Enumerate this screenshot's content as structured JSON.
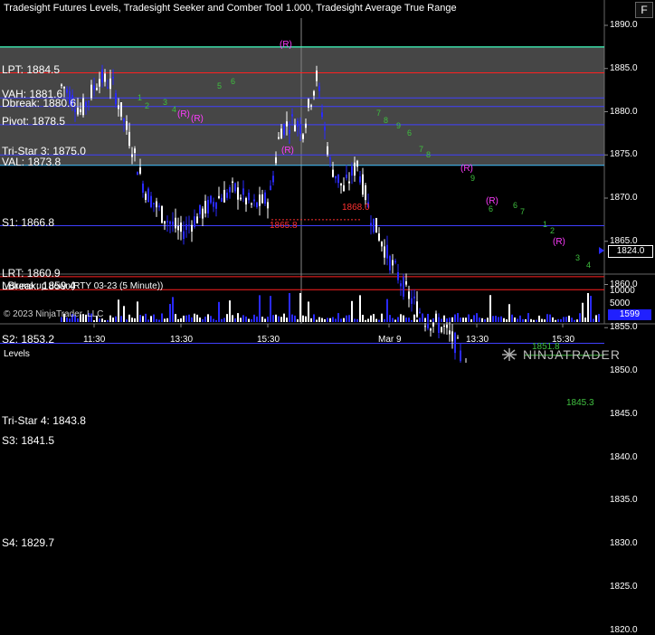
{
  "chart": {
    "indicator_line": "Tradesight Futures Levels, Tradesight Seeker and Comber Tool 1.000, Tradesight Average True Range",
    "volume_panel_label": "Volume up down(RTY 03-23 (5 Minute))",
    "copyright": "© 2023 NinjaTrader, LLC",
    "bottom_tab": "Levels",
    "f_button": "F",
    "brand": "NINJATRADER",
    "current_price": "1824.0",
    "current_volume": "1599"
  },
  "levels": [
    {
      "label": "Dbreak: 1880.6",
      "price": 1880.6,
      "color": "#4040ff"
    },
    {
      "label": "VAH: 1881.6",
      "price": 1881.6,
      "color": "#4040ff"
    },
    {
      "label": "LPT: 1884.5",
      "price": 1884.5,
      "color": "#ff2020"
    },
    {
      "label": "Pivot: 1878.5",
      "price": 1878.5,
      "color": "#4040ff"
    },
    {
      "label": "Tri-Star 3: 1875.0",
      "price": 1875.0,
      "color": "#4040ff"
    },
    {
      "label": "VAL: 1873.8",
      "price": 1873.8,
      "color": "#40c0ff"
    },
    {
      "label": "S1: 1866.8",
      "price": 1866.8,
      "color": "#4040ff"
    },
    {
      "label": "LRT: 1860.9",
      "price": 1860.9,
      "color": "#ff2020"
    },
    {
      "label": "LBreak: 1859.4",
      "price": 1859.4,
      "color": "#ff2020"
    },
    {
      "label": "S2: 1853.2",
      "price": 1853.2,
      "color": "#4040ff"
    },
    {
      "label": "Tri-Star 4: 1843.8",
      "price": 1843.8,
      "color": "#40c040"
    },
    {
      "label": "S3: 1841.5",
      "price": 1841.5,
      "color": "#4040ff"
    },
    {
      "label": "S4: 1829.7",
      "price": 1829.7,
      "color": "#4040ff"
    }
  ],
  "y_axis": [
    "1890.0",
    "1885.0",
    "1880.0",
    "1875.0",
    "1870.0",
    "1865.0",
    "1860.0",
    "1855.0",
    "1850.0",
    "1845.0",
    "1840.0",
    "1835.0",
    "1830.0",
    "1825.0",
    "1820.0"
  ],
  "vol_axis": [
    "10000",
    "5000"
  ],
  "x_axis": [
    "11:30",
    "13:30",
    "15:30",
    "Mar 9",
    "13:30",
    "15:30"
  ],
  "tags": [
    {
      "text": "1865.8",
      "color": "#ff3030"
    },
    {
      "text": "1868.0",
      "color": "#ff3030"
    },
    {
      "text": "1851.8",
      "color": "#40c040"
    },
    {
      "text": "1845.3",
      "color": "#40c040"
    }
  ],
  "r_marks": [
    "(R)",
    "(R)",
    "(R)",
    "(R)",
    "(R)",
    "(R)",
    "(R)"
  ],
  "seeker_counts": [
    "1",
    "2",
    "3",
    "4",
    "5",
    "6",
    "7",
    "8",
    "9",
    "6",
    "7",
    "8",
    "9",
    "6",
    "6",
    "7",
    "1",
    "2",
    "3",
    "4"
  ]
}
